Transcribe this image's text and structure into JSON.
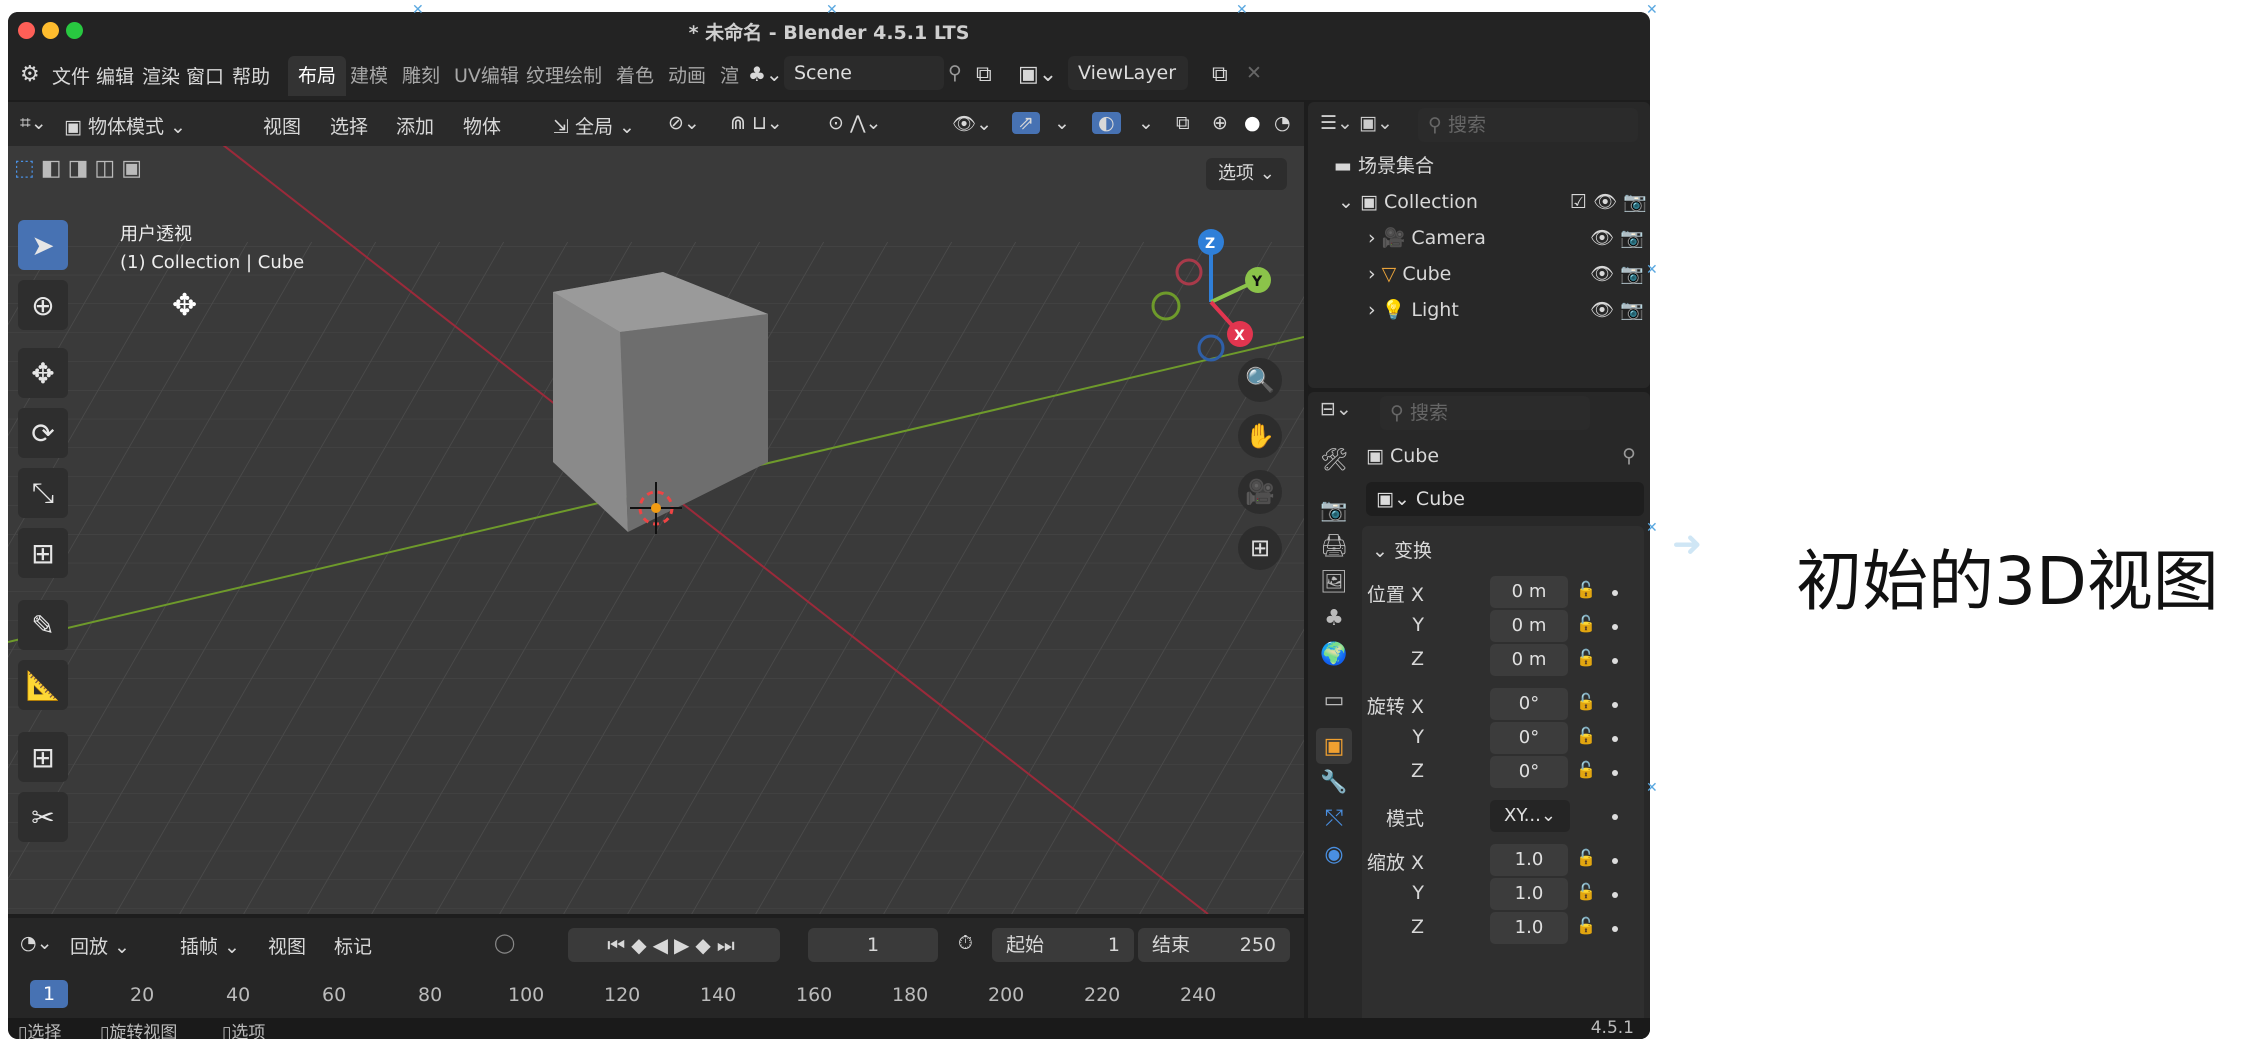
{
  "window": {
    "title": "* 未命名 - Blender 4.5.1 LTS"
  },
  "menu": {
    "items": [
      "文件",
      "编辑",
      "渲染",
      "窗口",
      "帮助"
    ]
  },
  "workspaces": [
    "布局",
    "建模",
    "雕刻",
    "UV编辑",
    "纹理绘制",
    "着色",
    "动画",
    "渲"
  ],
  "scene": {
    "name": "Scene",
    "viewlayer": "ViewLayer"
  },
  "viewport_header": {
    "mode": "物体模式",
    "items": [
      "视图",
      "选择",
      "添加",
      "物体"
    ],
    "orientation": "全局",
    "options_label": "选项"
  },
  "viewport": {
    "view_name": "用户透视",
    "context": "(1) Collection | Cube",
    "gizmo_axes": [
      "Z",
      "Y",
      "X"
    ]
  },
  "outliner": {
    "search_placeholder": "搜索",
    "scene_collection": "场景集合",
    "collection": "Collection",
    "objects": [
      "Camera",
      "Cube",
      "Light"
    ]
  },
  "properties": {
    "search_placeholder": "搜索",
    "object_name": "Cube",
    "data_name": "Cube",
    "section": "变换",
    "location_label": "位置",
    "rotation_label": "旋转",
    "scale_label": "缩放",
    "mode_label": "模式",
    "mode_value": "XY...",
    "axes": [
      "X",
      "Y",
      "Z"
    ],
    "location": [
      "0 m",
      "0 m",
      "0 m"
    ],
    "rotation": [
      "0°",
      "0°",
      "0°"
    ],
    "scale": [
      "1.0",
      "1.0",
      "1.0"
    ]
  },
  "timeline": {
    "menus": [
      "回放",
      "插帧",
      "视图",
      "标记"
    ],
    "current_frame": "1",
    "start_label": "起始",
    "start": "1",
    "end_label": "结束",
    "end": "250",
    "ticks": [
      "1",
      "20",
      "40",
      "60",
      "80",
      "100",
      "120",
      "140",
      "160",
      "180",
      "200",
      "220",
      "240"
    ]
  },
  "statusbar": {
    "items": [
      "选择",
      "旋转视图",
      "选项"
    ],
    "version": "4.5.1"
  },
  "caption": "初始的3D视图",
  "colors": {
    "accent": "#4772b3",
    "x_axis": "#e2354f",
    "y_axis": "#8bc34a",
    "z_axis": "#2f7fd8"
  }
}
